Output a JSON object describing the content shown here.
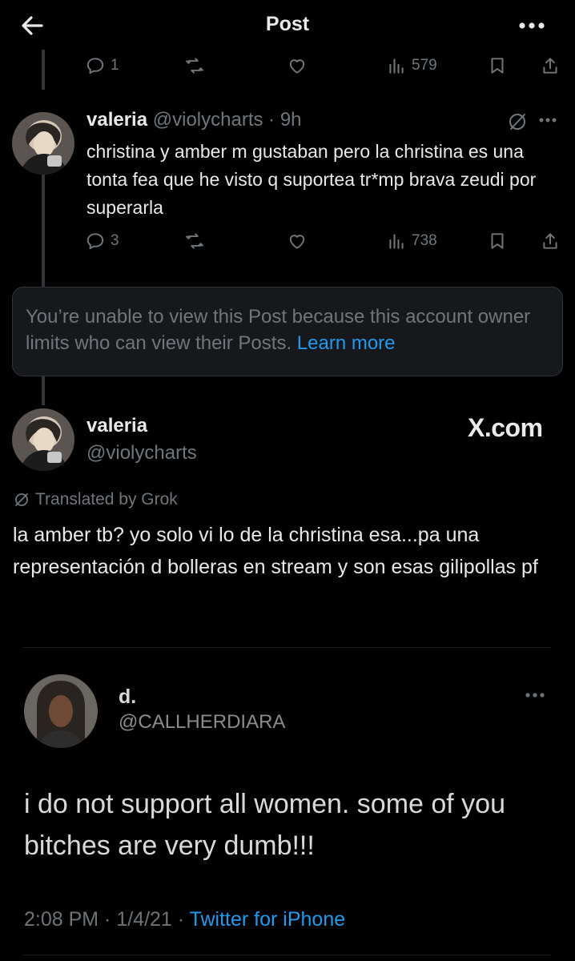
{
  "header": {
    "title": "Post"
  },
  "top_actions": {
    "replies": "1",
    "views": "579"
  },
  "reply_tweet": {
    "name": "valeria",
    "handle": "@violycharts",
    "time": "9h",
    "text": "christina y amber m gustaban pero la christina es una tonta fea que he visto q suportea tr*mp brava zeudi por superarla",
    "replies": "3",
    "views": "738"
  },
  "limited_notice": {
    "text": "You’re unable to view this Post because this account owner limits who can view their Posts.",
    "link": "Learn more"
  },
  "main_tweet": {
    "name": "valeria",
    "handle": "@violycharts",
    "watermark": "X.com",
    "translated_label": "Translated by Grok",
    "text": "la amber tb? yo solo vi lo de la christina esa...pa una representación d bolleras en stream y son esas gilipollas pf"
  },
  "embedded_tweet": {
    "name": "d.",
    "handle": "@CALLHERDIARA",
    "text": "i do not support all women. some of you bitches are very dumb!!!",
    "time": "2:08 PM",
    "date": "1/4/21",
    "source": "Twitter for iPhone"
  },
  "colors": {
    "background": "#000000",
    "text": "#e7e9ea",
    "muted": "#71767b",
    "accent": "#1d9bf0"
  },
  "icons": [
    "back-arrow-icon",
    "more-icon",
    "reply-icon",
    "retweet-icon",
    "like-icon",
    "views-icon",
    "bookmark-icon",
    "share-icon",
    "grok-icon"
  ]
}
